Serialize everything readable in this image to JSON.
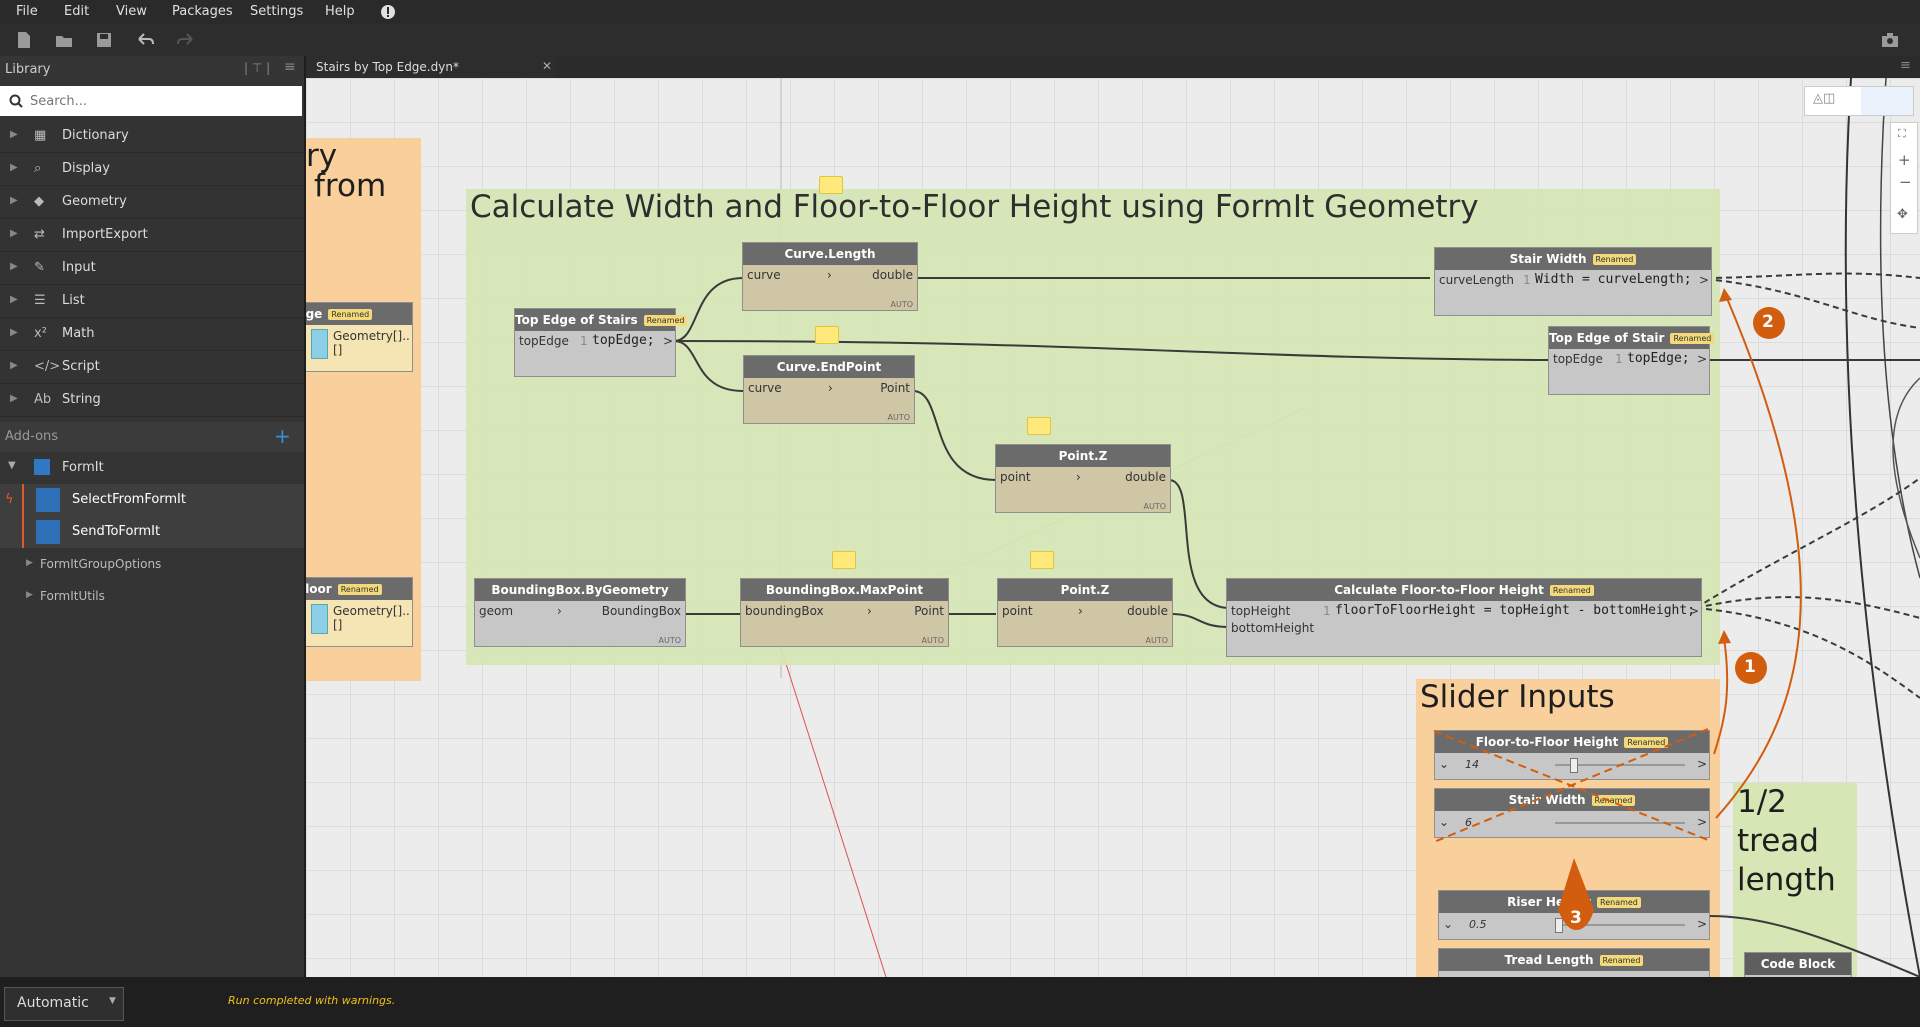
{
  "menu": {
    "items": [
      "File",
      "Edit",
      "View",
      "Packages",
      "Settings",
      "Help"
    ]
  },
  "library": {
    "title": "Library",
    "search_placeholder": "Search...",
    "categories": [
      {
        "label": "Dictionary",
        "icon": "dictionary-icon"
      },
      {
        "label": "Display",
        "icon": "display-icon"
      },
      {
        "label": "Geometry",
        "icon": "geometry-icon"
      },
      {
        "label": "ImportExport",
        "icon": "importexport-icon"
      },
      {
        "label": "Input",
        "icon": "input-icon"
      },
      {
        "label": "List",
        "icon": "list-icon"
      },
      {
        "label": "Math",
        "icon": "math-icon"
      },
      {
        "label": "Script",
        "icon": "script-icon"
      },
      {
        "label": "String",
        "icon": "string-icon"
      }
    ],
    "addons_label": "Add-ons",
    "formit": {
      "label": "FormIt",
      "children": [
        "SelectFromFormIt",
        "SendToFormIt"
      ],
      "subgroups": [
        "FormItGroupOptions",
        "FormItUtils"
      ]
    }
  },
  "tab": {
    "label": "Stairs by Top Edge.dyn*"
  },
  "groups": {
    "left_title_1": "ry",
    "left_title_2": "from",
    "main_title": "Calculate Width and Floor-to-Floor Height using FormIt Geometry",
    "slider_title": "Slider Inputs",
    "half_tread_title": "1/2\ntread\nlength"
  },
  "nodes": {
    "renamed_badge": "Renamed",
    "auto_label": "AUTO",
    "left_top_edge": {
      "title": "dge",
      "output": "Geometry[]..[]"
    },
    "left_floor": {
      "title": "Floor",
      "output": "Geometry[]..[]"
    },
    "top_edge_stairs": {
      "title": "Top Edge of Stairs",
      "input": "topEdge",
      "line": "1",
      "code": "topEdge;",
      "out": ">"
    },
    "curve_length": {
      "title": "Curve.Length",
      "input": "curve",
      "output": "double"
    },
    "curve_endpoint": {
      "title": "Curve.EndPoint",
      "input": "curve",
      "output": "Point"
    },
    "point_z_1": {
      "title": "Point.Z",
      "input": "point",
      "output": "double"
    },
    "stair_width": {
      "title": "Stair Width",
      "input": "curveLength",
      "line": "1",
      "code": "Width = curveLength;",
      "out": ">"
    },
    "top_edge_stair": {
      "title": "Top Edge of Stair",
      "input": "topEdge",
      "line": "1",
      "code": "topEdge;",
      "out": ">"
    },
    "bbox_geom": {
      "title": "BoundingBox.ByGeometry",
      "input": "geom",
      "output": "BoundingBox"
    },
    "bbox_max": {
      "title": "BoundingBox.MaxPoint",
      "input": "boundingBox",
      "output": "Point"
    },
    "point_z_2": {
      "title": "Point.Z",
      "input": "point",
      "output": "double"
    },
    "calc_floor": {
      "title": "Calculate Floor-to-Floor Height",
      "input1": "topHeight",
      "input2": "bottomHeight",
      "line": "1",
      "code": "floorToFloorHeight = topHeight - bottomHeight;",
      "out": ">"
    },
    "slider_ftf": {
      "title": "Floor-to-Floor Height",
      "value": "14"
    },
    "slider_width": {
      "title": "Stair Width",
      "value": "6"
    },
    "slider_riser": {
      "title": "Riser Height",
      "value": "0.5"
    },
    "slider_tread": {
      "title": "Tread Length"
    },
    "code_block": {
      "title": "Code Block"
    }
  },
  "annotations": {
    "one": "1",
    "two": "2",
    "three": "3"
  },
  "status": {
    "run_mode": "Automatic",
    "message": "Run completed with warnings."
  },
  "colors": {
    "annotation": "#d35d0e",
    "group_green": "#d6e6b4",
    "group_orange": "#f9cf9b",
    "status_text": "#f0c020"
  }
}
